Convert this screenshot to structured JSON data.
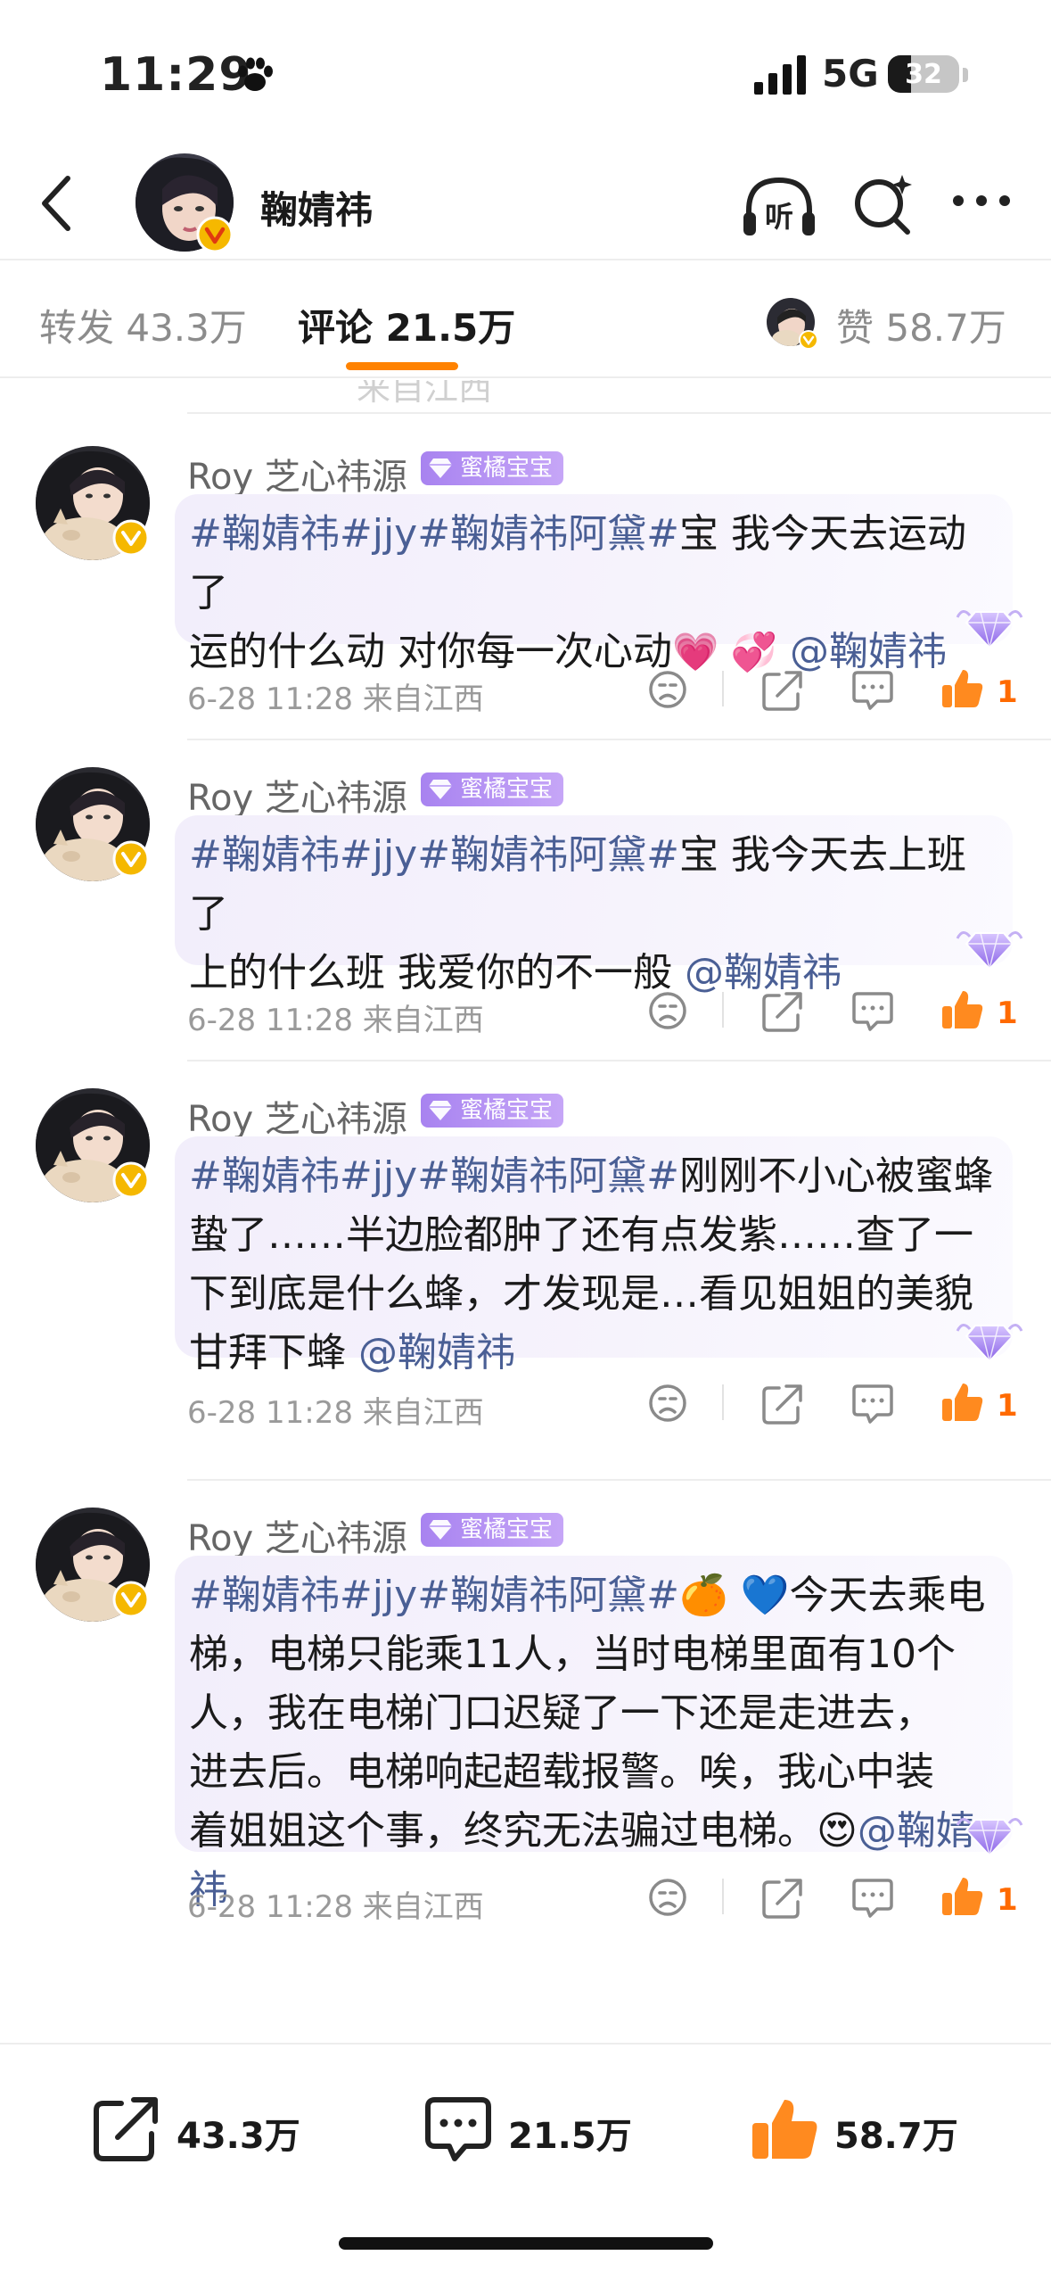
{
  "status": {
    "time": "11:29",
    "network": "5G",
    "battery": "32",
    "battery_level": 0.32
  },
  "header": {
    "name": "鞠婧祎"
  },
  "tabs": {
    "repost": "转发 43.3万",
    "comments": "评论 21.5万",
    "likes": "赞 58.7万"
  },
  "partial_row": {
    "text": "来自江西"
  },
  "comments": [
    {
      "user": "Roy 芝心祎源",
      "badge": "蜜橘宝宝",
      "tags": "#鞠婧祎#jjy#鞠婧祎阿黛#",
      "body": "宝 我今天去运动了运的什么动 对你每一次心动",
      "emoji": "💗 💞",
      "mention": "@鞠婧祎",
      "meta": "6-28 11:28 来自江西",
      "likes": "1"
    },
    {
      "user": "Roy 芝心祎源",
      "badge": "蜜橘宝宝",
      "tags": "#鞠婧祎#jjy#鞠婧祎阿黛#",
      "body": "宝 我今天去上班了上的什么班 我爱你的不一般 ",
      "emoji": "",
      "mention": "@鞠婧祎",
      "meta": "6-28 11:28 来自江西",
      "likes": "1"
    },
    {
      "user": "Roy 芝心祎源",
      "badge": "蜜橘宝宝",
      "tags": "#鞠婧祎#jjy#鞠婧祎阿黛#",
      "body": "刚刚不小心被蜜蜂蛰了……半边脸都肿了还有点发紫……查了一下到底是什么蜂，才发现是…看见姐姐的美貌甘拜下蜂 ",
      "emoji": "",
      "mention": "@鞠婧祎",
      "meta": "6-28 11:28 来自江西",
      "likes": "1"
    },
    {
      "user": "Roy 芝心祎源",
      "badge": "蜜橘宝宝",
      "tags": "#鞠婧祎#jjy#鞠婧祎阿黛#",
      "body": "🍊 💙今天去乘电梯，电梯只能乘11人，当时电梯里面有10个人，我在电梯门口迟疑了一下还是走进去，进去后。电梯响起超载报警。唉，我心中装着姐姐这个事，终究无法骗过电梯。😍",
      "emoji": "",
      "mention": "@鞠婧祎",
      "meta": "6-28 11:28 来自江西",
      "likes": "1"
    }
  ],
  "bottom": {
    "repost": "43.3万",
    "comment": "21.5万",
    "like": "58.7万"
  },
  "colors": {
    "accent": "#ff8200",
    "link": "#4a5f95",
    "like": "#ff6a00",
    "badge": "#a883f0",
    "vip": "#f5b800"
  }
}
